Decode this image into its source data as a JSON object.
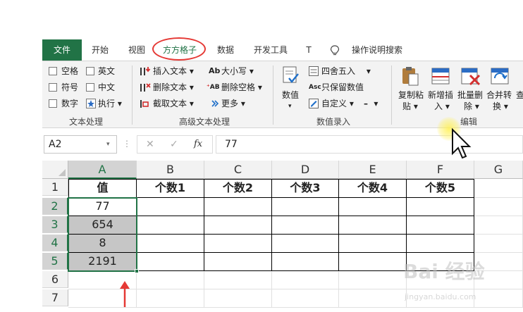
{
  "ribbon_tabs": [
    "文件",
    "开始",
    "视图",
    "方方格子",
    "数据",
    "开发工具",
    "T",
    "操作说明搜索"
  ],
  "text_group": {
    "checkboxes": [
      "空格",
      "英文",
      "符号",
      "中文",
      "数字"
    ],
    "execute_label": "执行",
    "group_label": "文本处理"
  },
  "advanced_text": {
    "insert_label": "插入文本",
    "delete_label": "删除文本",
    "cut_label": "截取文本",
    "case_label": "大小写",
    "delete_space_label": "删除空格",
    "more_label": "更多",
    "group_label": "高级文本处理"
  },
  "numeric": {
    "value_label": "数值",
    "round_label": "四舍五入",
    "keep_numeric_label": "只保留数值",
    "custom_label": "自定义",
    "group_label": "数值录入"
  },
  "edit_group": {
    "copy_paste_line1": "复制粘",
    "copy_paste_line2": "贴",
    "new_insert_line1": "新增插",
    "new_insert_line2": "入",
    "batch_delete_line1": "批量删",
    "batch_delete_line2": "除",
    "merge_convert_line1": "合并转",
    "merge_convert_line2": "换",
    "cut_off_label": "查",
    "group_label": "编辑"
  },
  "formula_bar": {
    "name_box": "A2",
    "fx_label": "fx",
    "formula_value": "77"
  },
  "columns": [
    "A",
    "B",
    "C",
    "D",
    "E",
    "F",
    "G"
  ],
  "rows": [
    "1",
    "2",
    "3",
    "4",
    "5",
    "6",
    "7"
  ],
  "header_row": [
    "值",
    "个数1",
    "个数2",
    "个数3",
    "个数4",
    "个数5"
  ],
  "values": [
    "77",
    "654",
    "8",
    "2191"
  ],
  "watermark": {
    "line1": "Bai 经验",
    "line2": "jingyan.baidu.com"
  },
  "colors": {
    "excel_green": "#217346",
    "annotation_red": "#e53935",
    "selection_gray": "#c6c6c6"
  }
}
